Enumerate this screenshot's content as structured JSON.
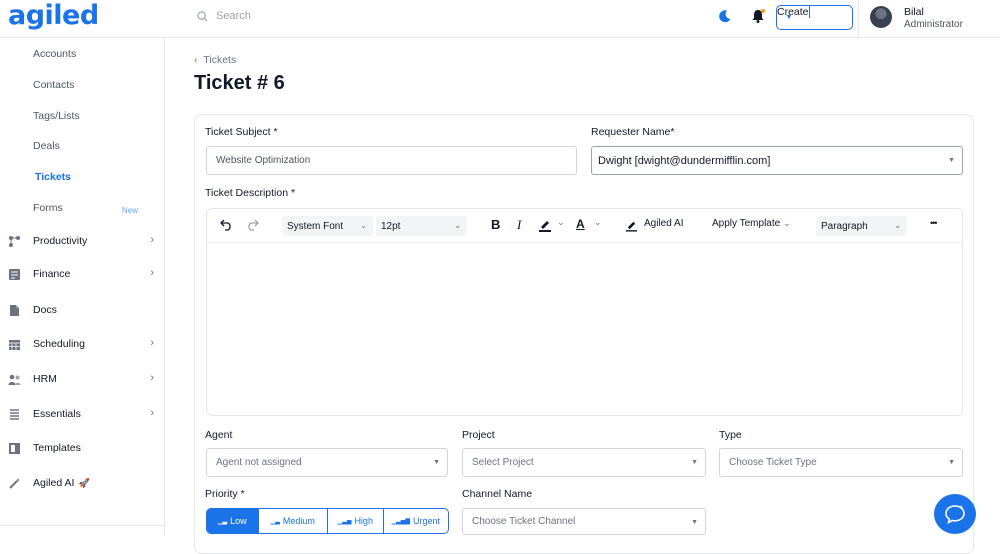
{
  "brand": {
    "logo_text": "agiled"
  },
  "header": {
    "search_placeholder": "Search",
    "create_label": "Create",
    "user_name": "Bilal",
    "user_role": "Administrator"
  },
  "sidebar": {
    "sub_items": [
      "Accounts",
      "Contacts",
      "Tags/Lists",
      "Deals",
      "Tickets",
      "Forms"
    ],
    "forms_badge": "New",
    "nav_items": [
      "Productivity",
      "Finance",
      "Docs",
      "Scheduling",
      "HRM",
      "Essentials",
      "Templates",
      "Agiled AI"
    ],
    "agiled_ai_emoji": "🚀"
  },
  "page": {
    "breadcrumb": "Tickets",
    "title": "Ticket # 6"
  },
  "form": {
    "subject_label": "Ticket Subject *",
    "subject_value": "Website Optimization",
    "requester_label": "Requester Name*",
    "requester_value": "Dwight [dwight@dundermifflin.com]",
    "description_label": "Ticket Description *",
    "agent_label": "Agent",
    "agent_value": "Agent not assigned",
    "project_label": "Project",
    "project_placeholder": "Select Project",
    "type_label": "Type",
    "type_placeholder": "Choose Ticket Type",
    "priority_label": "Priority *",
    "priority_options": [
      "Low",
      "Medium",
      "High",
      "Urgent"
    ],
    "priority_selected": "Low",
    "channel_label": "Channel Name",
    "channel_placeholder": "Choose Ticket Channel"
  },
  "editor_toolbar": {
    "font_family": "System Font",
    "font_size": "12pt",
    "bold": "B",
    "italic": "I",
    "text_color": "A",
    "ai_label": "Agiled AI",
    "template_label": "Apply Template",
    "block_format": "Paragraph",
    "more": "•••"
  },
  "colors": {
    "accent": "#1a73e8"
  },
  "icons": [
    "search-icon",
    "moon-icon",
    "bell-icon",
    "chevron-down-icon",
    "chat-support-icon"
  ]
}
